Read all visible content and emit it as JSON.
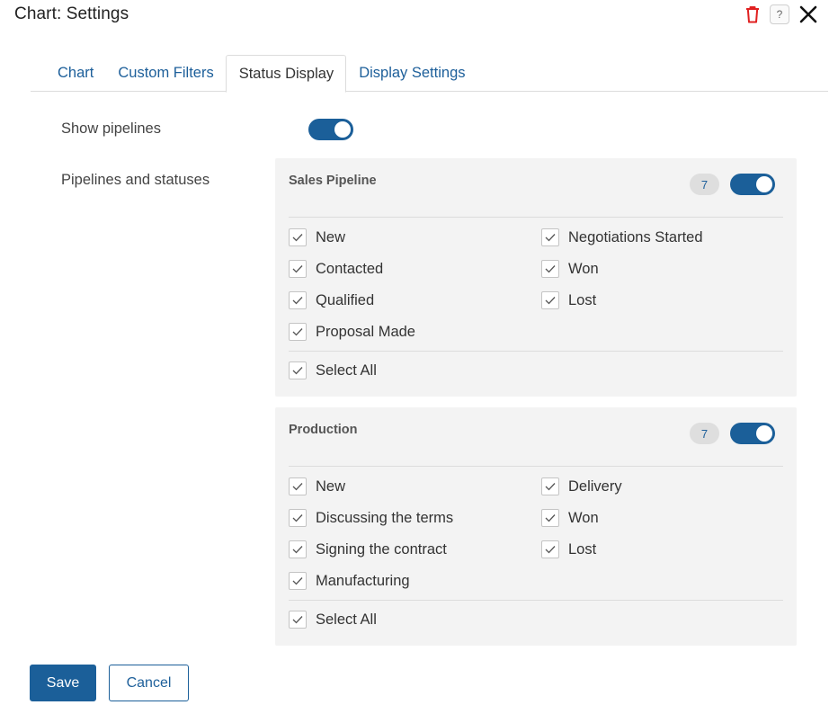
{
  "header": {
    "title": "Chart: Settings",
    "help_symbol": "?",
    "icons": [
      "trash-icon",
      "help-icon",
      "close-icon"
    ],
    "delete_icon_color": "#e02020"
  },
  "tabs": [
    {
      "label": "Chart",
      "active": false
    },
    {
      "label": "Custom Filters",
      "active": false
    },
    {
      "label": "Status Display",
      "active": true
    },
    {
      "label": "Display Settings",
      "active": false
    }
  ],
  "show_pipelines": {
    "label": "Show pipelines",
    "enabled": true
  },
  "pipelines_label": "Pipelines and statuses",
  "pipelines": [
    {
      "name": "Sales Pipeline",
      "count": "7",
      "enabled": true,
      "left_statuses": [
        "New",
        "Contacted",
        "Qualified",
        "Proposal Made"
      ],
      "right_statuses": [
        "Negotiations Started",
        "Won",
        "Lost"
      ],
      "select_all": "Select All",
      "all_checked": true
    },
    {
      "name": "Production",
      "count": "7",
      "enabled": true,
      "left_statuses": [
        "New",
        "Discussing the terms",
        "Signing the contract",
        "Manufacturing"
      ],
      "right_statuses": [
        "Delivery",
        "Won",
        "Lost"
      ],
      "select_all": "Select All",
      "all_checked": true
    }
  ],
  "footer": {
    "save_label": "Save",
    "cancel_label": "Cancel"
  },
  "colors": {
    "accent": "#1b5f99",
    "link": "#1d5f9a",
    "panel_bg": "#f3f3f3"
  }
}
